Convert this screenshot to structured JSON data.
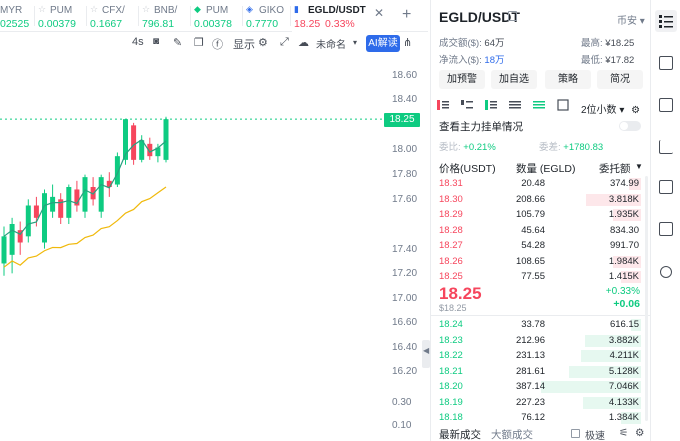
{
  "tabs": [
    {
      "symbol": "MYR",
      "price": "02525",
      "change": ""
    },
    {
      "symbol": "PUM",
      "price": "0.00379",
      "change": ""
    },
    {
      "symbol": "CFX/",
      "price": "0.1667",
      "change": ""
    },
    {
      "symbol": "BNB/",
      "price": "796.81",
      "change": ""
    },
    {
      "symbol": "PUM",
      "price": "0.00378",
      "change": ""
    },
    {
      "symbol": "GIKO",
      "price": "0.7770",
      "change": ""
    },
    {
      "symbol": "EGLD/USDT",
      "price": "18.25",
      "change": "0.33%"
    }
  ],
  "toolbar": {
    "interval": "4s",
    "display_label": "显示",
    "unnamed_label": "未命名",
    "ai_label": "AI解读"
  },
  "chart": {
    "y_ticks": [
      "18.60",
      "18.40",
      "18.00",
      "17.80",
      "17.60",
      "17.40",
      "17.20",
      "17.00",
      "16.60",
      "16.40",
      "16.20",
      "0.30",
      "0.10"
    ],
    "current_price": "18.25"
  },
  "chart_data": {
    "type": "candlestick",
    "y_ticks": [
      18.6,
      18.4,
      18.0,
      17.8,
      17.6,
      17.4,
      17.2,
      17.0,
      16.6,
      16.4,
      16.2
    ],
    "current_price": 18.25,
    "candles": [
      {
        "o": 17.08,
        "c": 17.3,
        "h": 17.38,
        "l": 16.98
      },
      {
        "o": 17.15,
        "c": 17.4,
        "h": 17.45,
        "l": 17.0
      },
      {
        "o": 17.35,
        "c": 17.25,
        "h": 17.42,
        "l": 17.15
      },
      {
        "o": 17.3,
        "c": 17.55,
        "h": 17.6,
        "l": 17.25
      },
      {
        "o": 17.55,
        "c": 17.45,
        "h": 17.62,
        "l": 17.38
      },
      {
        "o": 17.25,
        "c": 17.65,
        "h": 17.68,
        "l": 17.2
      },
      {
        "o": 17.5,
        "c": 17.62,
        "h": 17.72,
        "l": 17.45
      },
      {
        "o": 17.6,
        "c": 17.45,
        "h": 17.65,
        "l": 17.4
      },
      {
        "o": 17.45,
        "c": 17.7,
        "h": 17.72,
        "l": 17.4
      },
      {
        "o": 17.68,
        "c": 17.55,
        "h": 17.75,
        "l": 17.5
      },
      {
        "o": 17.5,
        "c": 17.78,
        "h": 17.8,
        "l": 17.45
      },
      {
        "o": 17.7,
        "c": 17.6,
        "h": 17.78,
        "l": 17.55
      },
      {
        "o": 17.5,
        "c": 17.78,
        "h": 17.8,
        "l": 17.45
      },
      {
        "o": 17.75,
        "c": 17.7,
        "h": 17.82,
        "l": 17.62
      },
      {
        "o": 17.72,
        "c": 17.95,
        "h": 17.98,
        "l": 17.7
      },
      {
        "o": 17.92,
        "c": 18.25,
        "h": 18.25,
        "l": 17.88
      },
      {
        "o": 18.2,
        "c": 17.92,
        "h": 18.22,
        "l": 17.88
      },
      {
        "o": 17.92,
        "c": 18.08,
        "h": 18.12,
        "l": 17.9
      },
      {
        "o": 18.05,
        "c": 17.95,
        "h": 18.1,
        "l": 17.92
      },
      {
        "o": 17.95,
        "c": 18.02,
        "h": 18.05,
        "l": 17.9
      },
      {
        "o": 17.92,
        "c": 18.25,
        "h": 18.27,
        "l": 17.9
      }
    ]
  },
  "panel": {
    "pair": "EGLD/USDT",
    "exchange": "币安",
    "volume_label": "成交额($):",
    "volume": "64万",
    "high_label": "最高:",
    "high": "¥18.25",
    "inflow_label": "净流入($):",
    "inflow": "18万",
    "low_label": "最低:",
    "low": "¥17.82",
    "buttons": [
      "加预警",
      "加自选",
      "策略",
      "简况"
    ],
    "precision": "2位小数",
    "main_order_label": "查看主力挂单情况",
    "ratio_label": "委比:",
    "ratio": "+0.21%",
    "diff_label": "委差:",
    "diff": "+1780.83",
    "col_price": "价格(USDT)",
    "col_qty": "数量 (EGLD)",
    "col_total": "委托额",
    "asks": [
      {
        "price": "18.31",
        "qty": "20.48",
        "total": "374.99",
        "w": 0.12
      },
      {
        "price": "18.30",
        "qty": "208.66",
        "total": "3.818K",
        "w": 0.55
      },
      {
        "price": "18.29",
        "qty": "105.79",
        "total": "1.935K",
        "w": 0.28
      },
      {
        "price": "18.28",
        "qty": "45.64",
        "total": "834.30",
        "w": 0.0
      },
      {
        "price": "18.27",
        "qty": "54.28",
        "total": "991.70",
        "w": 0.0
      },
      {
        "price": "18.26",
        "qty": "108.65",
        "total": "1.984K",
        "w": 0.28
      },
      {
        "price": "18.25",
        "qty": "77.55",
        "total": "1.415K",
        "w": 0.2
      }
    ],
    "last_price": "18.25",
    "last_sub": "$18.25",
    "last_change_pct": "+0.33%",
    "last_change": "+0.06",
    "bids": [
      {
        "price": "18.24",
        "qty": "33.78",
        "total": "616.15",
        "w": 0.1
      },
      {
        "price": "18.23",
        "qty": "212.96",
        "total": "3.882K",
        "w": 0.56
      },
      {
        "price": "18.22",
        "qty": "231.13",
        "total": "4.211K",
        "w": 0.6
      },
      {
        "price": "18.21",
        "qty": "281.61",
        "total": "5.128K",
        "w": 0.72
      },
      {
        "price": "18.20",
        "qty": "387.14",
        "total": "7.046K",
        "w": 1.0
      },
      {
        "price": "18.19",
        "qty": "227.23",
        "total": "4.133K",
        "w": 0.58
      },
      {
        "price": "18.18",
        "qty": "76.12",
        "total": "1.384K",
        "w": 0.2
      }
    ],
    "bottom_tabs": [
      "最新成交",
      "大额成交"
    ],
    "speed_label": "极速"
  },
  "colors": {
    "up": "#0ecb81",
    "down": "#f6465d",
    "ma1": "#27a17f",
    "ma2": "#f0b90b"
  }
}
